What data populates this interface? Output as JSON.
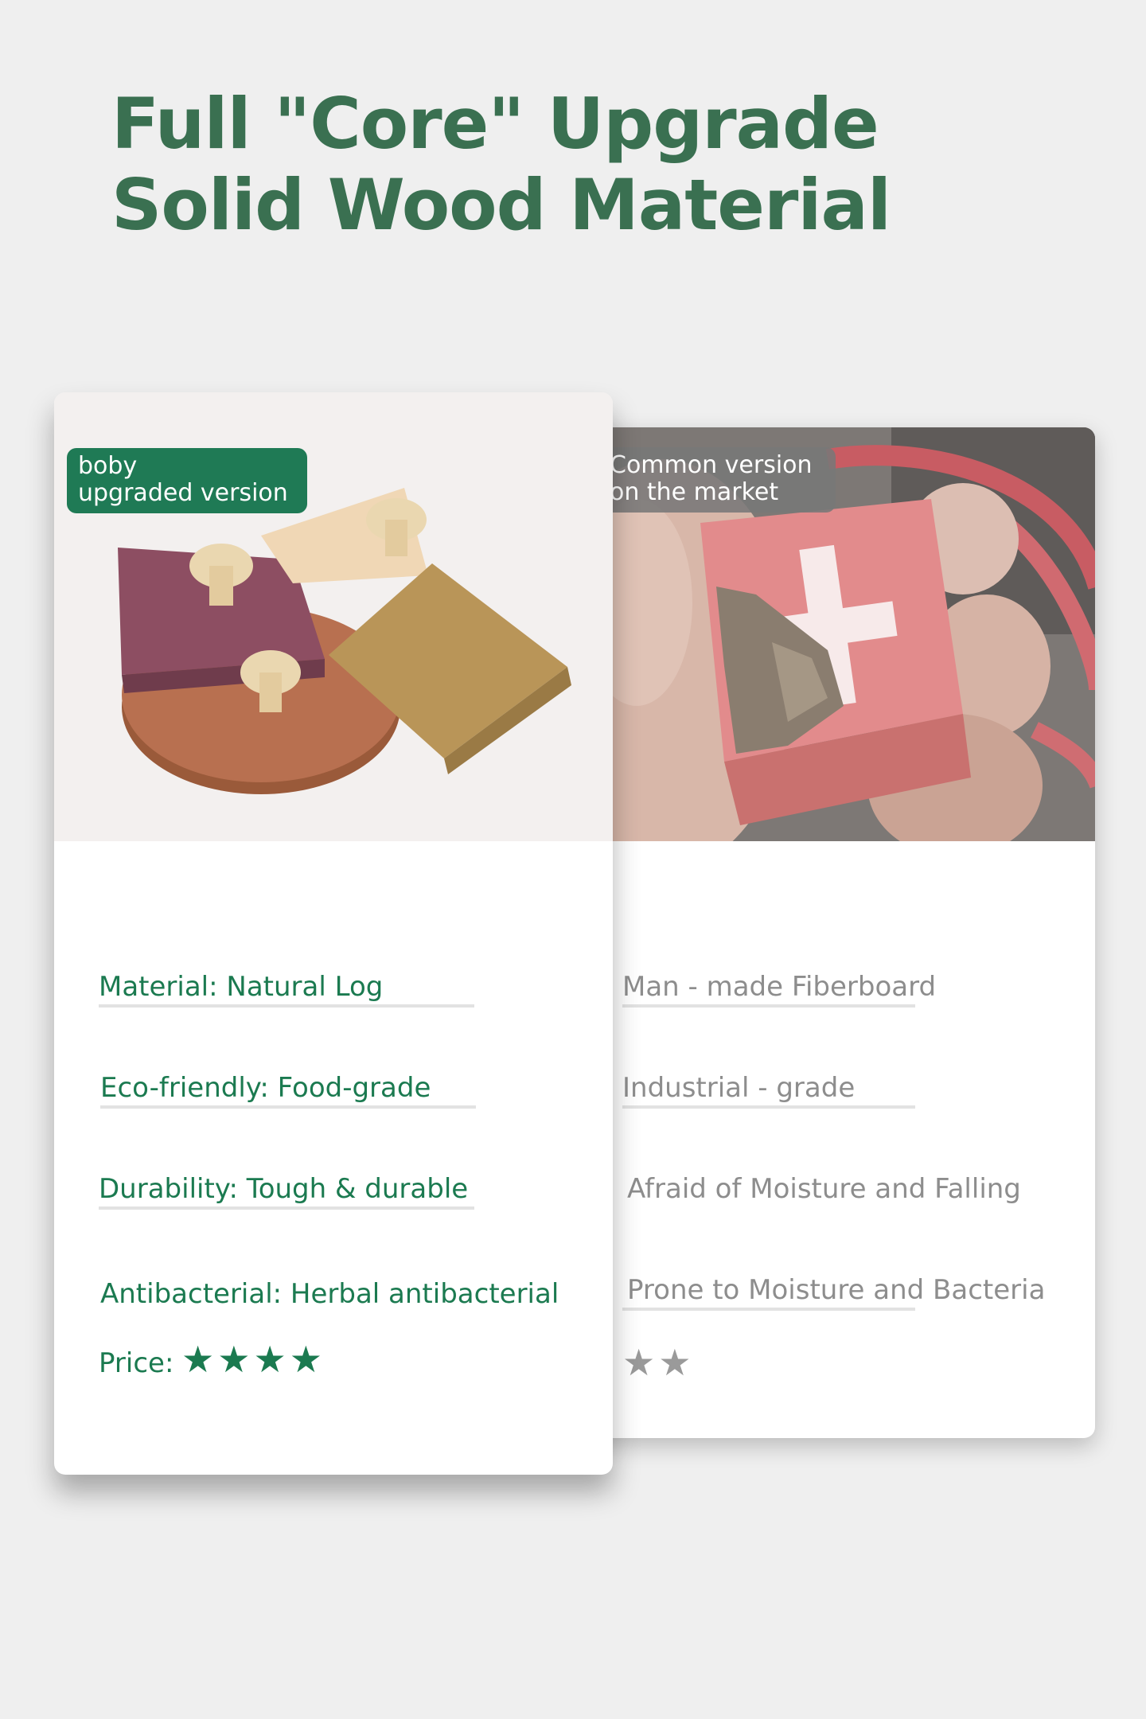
{
  "headline": {
    "line1": "Full \"Core\" Upgrade",
    "line2": "Solid Wood Material"
  },
  "left_card": {
    "badge_line1": "boby",
    "badge_line2": "upgraded version",
    "rows": [
      "Material: Natural Log",
      "Eco-friendly: Food-grade",
      "Durability: Tough & durable",
      "Antibacterial: Herbal antibacterial"
    ],
    "price_label": "Price:",
    "stars": "★★★★",
    "rating": 4
  },
  "right_card": {
    "badge_line1": "Common version",
    "badge_line2": "on the market",
    "rows": [
      "Man - made Fiberboard",
      "Industrial - grade",
      "Afraid of Moisture and Falling",
      "Prone to Moisture and Bacteria"
    ],
    "stars": "★★",
    "rating": 2
  },
  "colors": {
    "headline": "#3a7051",
    "accent_green": "#1b7a50",
    "muted_gray": "#8d8d8d",
    "background": "#efefef"
  }
}
